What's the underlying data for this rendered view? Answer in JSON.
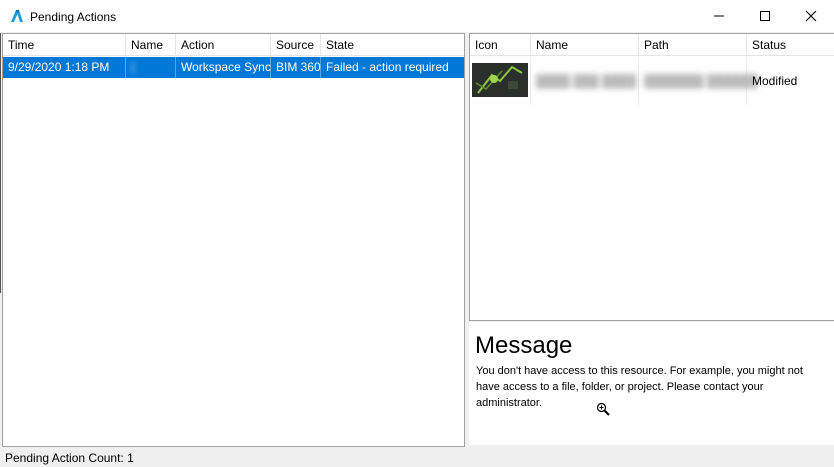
{
  "window": {
    "title": "Pending Actions"
  },
  "actions_table": {
    "columns": [
      "Time",
      "Name",
      "Action",
      "Source",
      "State"
    ],
    "rows": [
      {
        "time": "9/29/2020 1:18 PM",
        "name": "(",
        "action": "Workspace Sync",
        "source": "BIM 360",
        "state": "Failed - action required"
      }
    ]
  },
  "files_table": {
    "columns": [
      "Icon",
      "Name",
      "Path",
      "Status"
    ],
    "rows": [
      {
        "name": "████ ███ ████",
        "path": "███████ ██████",
        "status": "Modified"
      }
    ]
  },
  "message": {
    "title": "Message",
    "body": "You don't have access to this resource. For example, you might not have access to a file, folder, or project.  Please contact your administrator."
  },
  "status_bar": {
    "text": "Pending Action Count: 1"
  },
  "colors": {
    "selection": "#0078d7",
    "accent": "#1b9ad6"
  }
}
